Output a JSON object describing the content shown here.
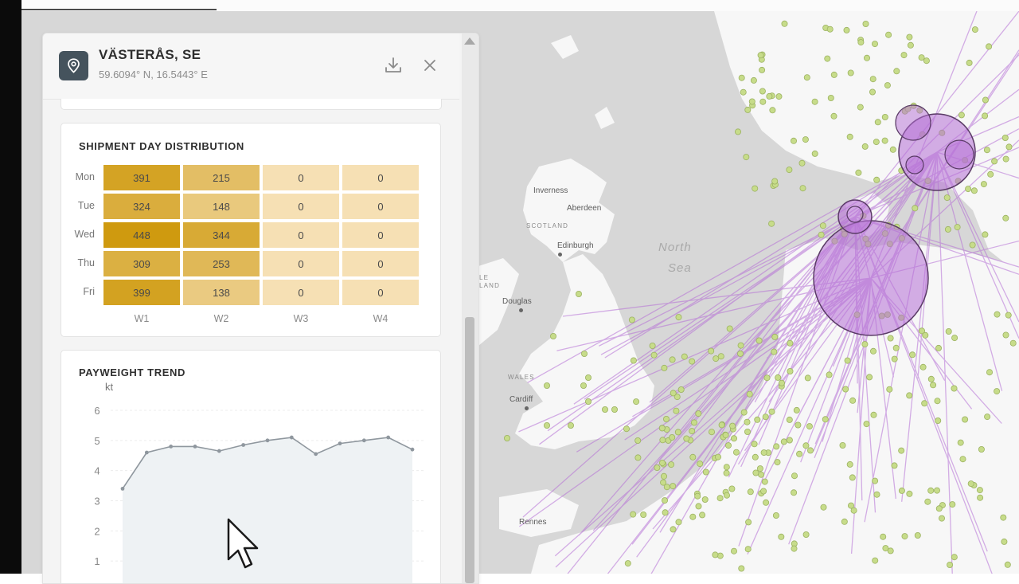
{
  "panel": {
    "title": "VÄSTERÅS, SE",
    "coords": "59.6094° N, 16.5443° E",
    "icons": {
      "location": "map-pin-icon",
      "download": "download-icon",
      "close": "close-icon"
    }
  },
  "heatmap": {
    "title": "SHIPMENT DAY DISTRIBUTION",
    "rows": [
      "Mon",
      "Tue",
      "Wed",
      "Thu",
      "Fri"
    ],
    "columns": [
      "W1",
      "W2",
      "W3",
      "W4"
    ],
    "values": [
      [
        391,
        215,
        0,
        0
      ],
      [
        324,
        148,
        0,
        0
      ],
      [
        448,
        344,
        0,
        0
      ],
      [
        309,
        253,
        0,
        0
      ],
      [
        399,
        138,
        0,
        0
      ]
    ],
    "value_text": [
      [
        "391",
        "215",
        "0",
        "0"
      ],
      [
        "324",
        "148",
        "0",
        "0"
      ],
      [
        "448",
        "344",
        "0",
        "0"
      ],
      [
        "309",
        "253",
        "0",
        "0"
      ],
      [
        "399",
        "138",
        "0",
        "0"
      ]
    ],
    "color_low": "#f6e0b4",
    "color_high": "#cf9a0f"
  },
  "chart_data": {
    "type": "area",
    "title": "PAYWEIGHT TREND",
    "ylabel": "kt",
    "yticks": [
      "6",
      "5",
      "4",
      "3",
      "2",
      "1"
    ],
    "ylim": [
      0,
      6
    ],
    "grid": true,
    "values": [
      3.4,
      4.6,
      4.8,
      4.8,
      4.65,
      4.85,
      5.0,
      5.1,
      4.55,
      4.9,
      5.0,
      5.1,
      4.7
    ],
    "line_color": "#8f979e",
    "fill_color": "#eef2f4"
  },
  "map": {
    "labels": {
      "inverness": "Inverness",
      "aberdeen": "Aberdeen",
      "scotland": "SCOTLAND",
      "edinburgh": "Edinburgh",
      "north_sea_1": "North",
      "north_sea_2": "Sea",
      "wales": "WALES",
      "cardiff": "Cardiff",
      "douglas": "Douglas",
      "isle_of_man_1": "LE",
      "isle_of_man_2": "LAND",
      "rennes": "Rennes"
    },
    "colors": {
      "flow": "#b56fd6",
      "site": "#c7dc8a",
      "land": "#f7f7f7",
      "water": "#d6d6d6"
    }
  }
}
